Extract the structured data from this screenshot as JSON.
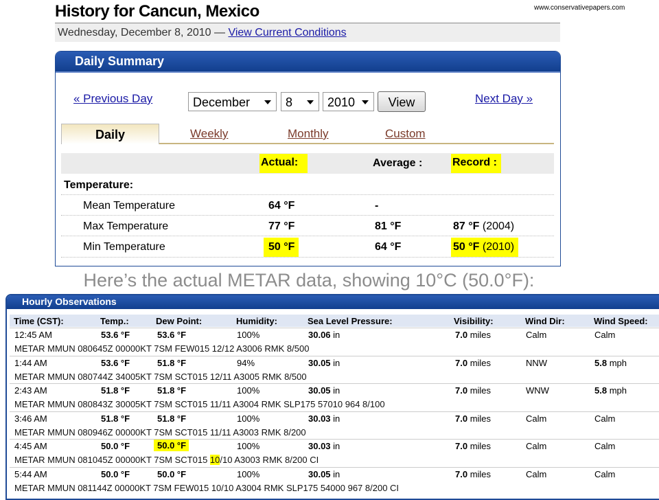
{
  "header": {
    "title": "History for Cancun, Mexico",
    "watermark": "www.conservativepapers.com",
    "date_text": "Wednesday, December 8, 2010 —",
    "current_link": "View Current Conditions"
  },
  "daily": {
    "title": "Daily Summary",
    "prev": "« Previous Day",
    "next": "Next Day »",
    "month": "December",
    "day": "8",
    "year": "2010",
    "view": "View",
    "tabs": {
      "daily": "Daily",
      "weekly": "Weekly",
      "monthly": "Monthly",
      "custom": "Custom"
    },
    "cols": {
      "actual": "Actual:",
      "average": "Average :",
      "record": "Record :"
    },
    "section": "Temperature:",
    "rows": [
      {
        "label": "Mean Temperature",
        "actual": "64 °F",
        "average": "-",
        "record_val": "",
        "record_year": ""
      },
      {
        "label": "Max Temperature",
        "actual": "77 °F",
        "average": "81 °F",
        "record_val": "87 °F",
        "record_year": "(2004)"
      },
      {
        "label": "Min Temperature",
        "actual": "50 °F",
        "average": "64 °F",
        "record_val": "50 °F",
        "record_year": "(2010)"
      }
    ]
  },
  "caption": "Here’s the actual METAR data, showing 10°C (50.0°F):",
  "hourly": {
    "title": "Hourly Observations",
    "headers": [
      "Time (CST):",
      "Temp.:",
      "Dew Point:",
      "Humidity:",
      "Sea Level Pressure:",
      "Visibility:",
      "Wind Dir:",
      "Wind Speed:"
    ],
    "rows": [
      {
        "time": "12:45 AM",
        "temp": "53.6 °F",
        "dew": "53.6 °F",
        "hum": "100%",
        "pres": "30.06",
        "pres_unit": "in",
        "vis": "7.0",
        "vis_unit": "miles",
        "dir": "Calm",
        "speed": "Calm",
        "speed_unit": "",
        "metar": "METAR MMUN 080645Z 00000KT 7SM FEW015 12/12 A3006 RMK 8/500"
      },
      {
        "time": "1:44 AM",
        "temp": "53.6 °F",
        "dew": "51.8 °F",
        "hum": "94%",
        "pres": "30.05",
        "pres_unit": "in",
        "vis": "7.0",
        "vis_unit": "miles",
        "dir": "NNW",
        "speed": "5.8",
        "speed_unit": "mph",
        "metar": "METAR MMUN 080744Z 34005KT 7SM SCT015 12/11 A3005 RMK 8/500"
      },
      {
        "time": "2:43 AM",
        "temp": "51.8 °F",
        "dew": "51.8 °F",
        "hum": "100%",
        "pres": "30.05",
        "pres_unit": "in",
        "vis": "7.0",
        "vis_unit": "miles",
        "dir": "WNW",
        "speed": "5.8",
        "speed_unit": "mph",
        "metar": "METAR MMUN 080843Z 30005KT 7SM SCT015 11/11 A3004 RMK SLP175 57010 964 8/100"
      },
      {
        "time": "3:46 AM",
        "temp": "51.8 °F",
        "dew": "51.8 °F",
        "hum": "100%",
        "pres": "30.03",
        "pres_unit": "in",
        "vis": "7.0",
        "vis_unit": "miles",
        "dir": "Calm",
        "speed": "Calm",
        "speed_unit": "",
        "metar": "METAR MMUN 080946Z 00000KT 7SM SCT015 11/11 A3003 RMK 8/200"
      },
      {
        "time": "4:45 AM",
        "temp": "50.0 °F",
        "dew": "50.0 °F",
        "hum": "100%",
        "pres": "30.03",
        "pres_unit": "in",
        "vis": "7.0",
        "vis_unit": "miles",
        "dir": "Calm",
        "speed": "Calm",
        "speed_unit": "",
        "metar_pre": "METAR MMUN 081045Z 00000KT 7SM SCT015 ",
        "metar_hl": "10",
        "metar_post": "/10 A3003 RMK 8/200 CI"
      },
      {
        "time": "5:44 AM",
        "temp": "50.0 °F",
        "dew": "50.0 °F",
        "hum": "100%",
        "pres": "30.05",
        "pres_unit": "in",
        "vis": "7.0",
        "vis_unit": "miles",
        "dir": "Calm",
        "speed": "Calm",
        "speed_unit": "",
        "metar": "METAR MMUN 081144Z 00000KT 7SM FEW015 10/10 A3004 RMK SLP175 54000 967 8/200 CI"
      }
    ]
  },
  "colors": {
    "panel_blue": "#1e4a96",
    "highlight": "#ffff00",
    "link": "#1a1aa6"
  }
}
